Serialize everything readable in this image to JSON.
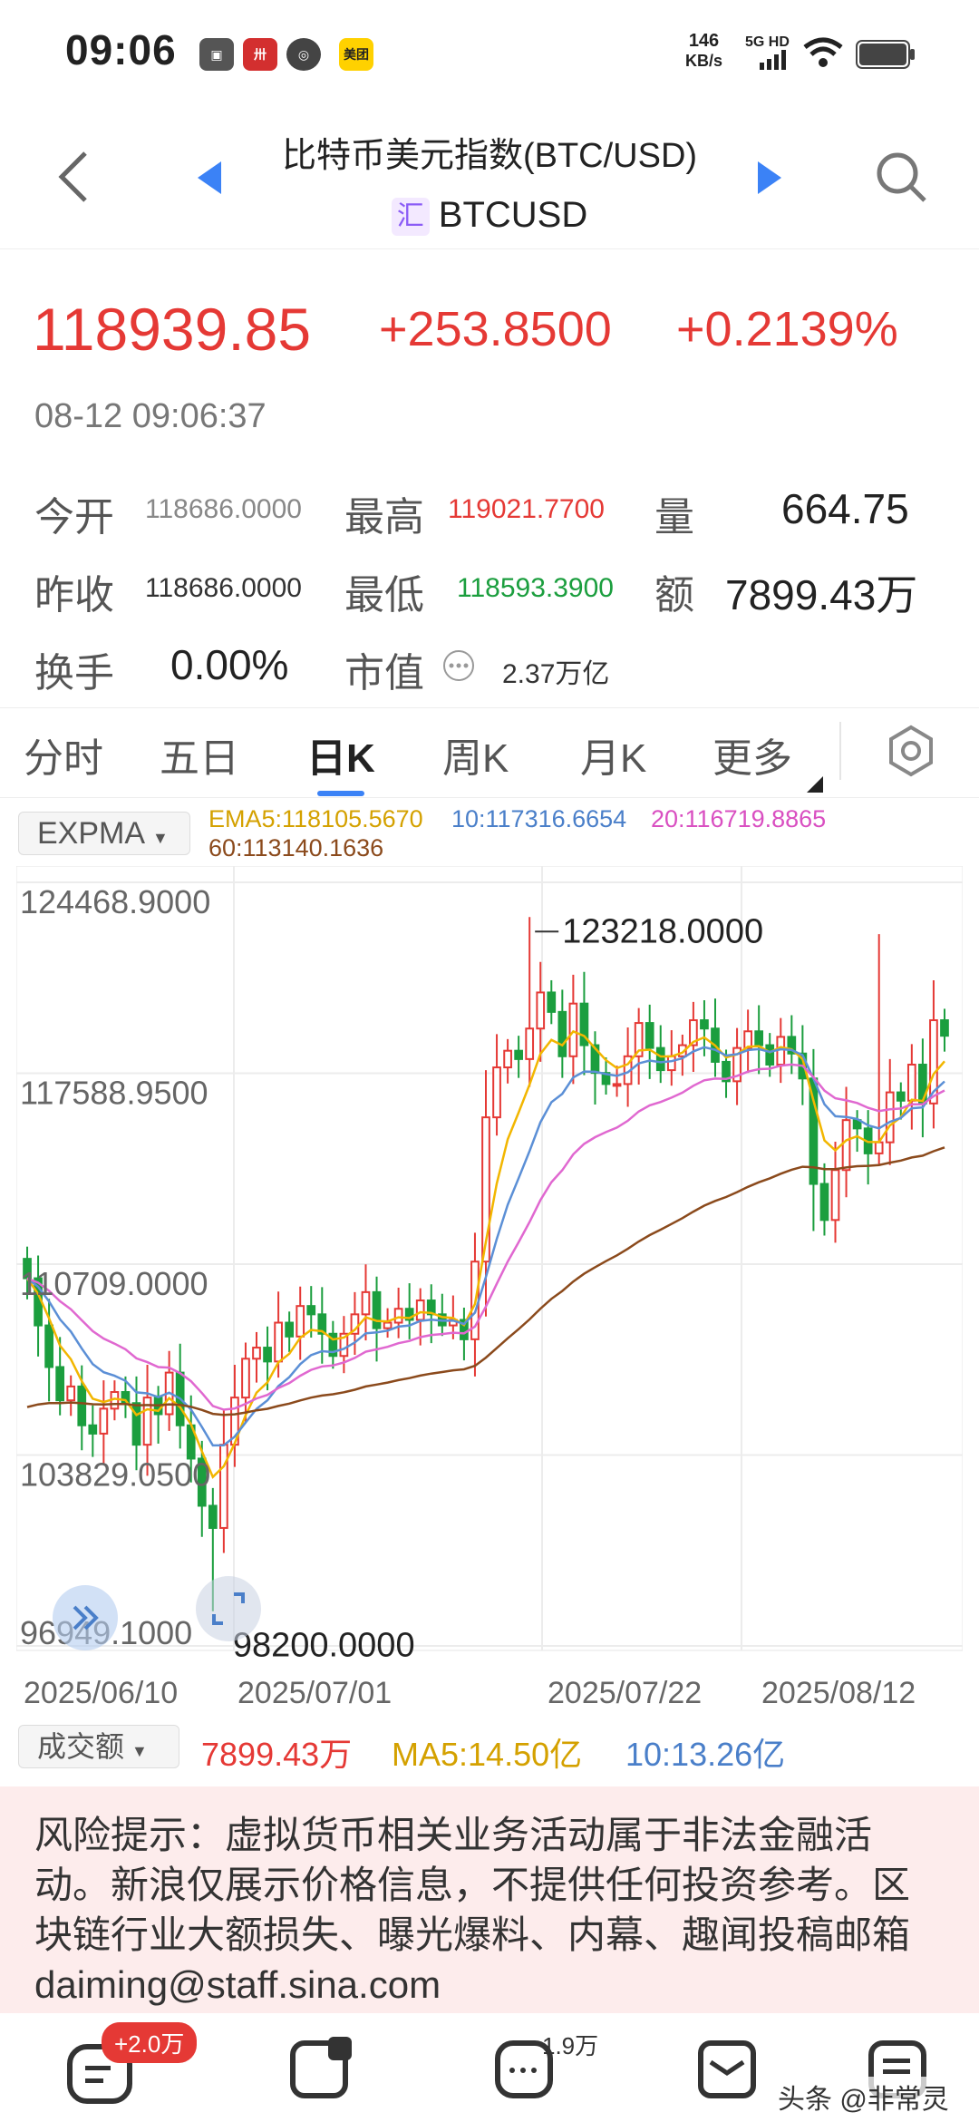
{
  "status": {
    "time": "09:06",
    "net_speed": "146",
    "net_unit": "KB/s",
    "signal": "5G HD",
    "apps": [
      "美团"
    ]
  },
  "nav": {
    "title": "比特币美元指数(BTC/USD)",
    "symbol_tag": "汇",
    "symbol": "BTCUSD"
  },
  "quote": {
    "price": "118939.85",
    "change": "+253.8500",
    "change_pct": "+0.2139%",
    "timestamp": "08-12 09:06:37"
  },
  "stats": {
    "open_label": "今开",
    "open": "118686.0000",
    "high_label": "最高",
    "high": "119021.7700",
    "vol_label": "量",
    "vol": "664.75",
    "prev_label": "昨收",
    "prev": "118686.0000",
    "low_label": "最低",
    "low": "118593.3900",
    "amount_label": "额",
    "amount": "7899.43万",
    "turnover_label": "换手",
    "turnover": "0.00%",
    "mcap_label": "市值",
    "mcap": "2.37万亿"
  },
  "tabs": [
    "分时",
    "五日",
    "日K",
    "周K",
    "月K",
    "更多"
  ],
  "indicator": {
    "name": "EXPMA",
    "ema5": "EMA5:118105.5670",
    "ema10": "10:117316.6654",
    "ema20": "20:116719.8865",
    "ema60": "60:113140.1636"
  },
  "chart_data": {
    "type": "candlestick",
    "y_ticks": [
      "124468.9000",
      "117588.9500",
      "110709.0000",
      "103829.0500",
      "96949.1000"
    ],
    "ylim": [
      96949.1,
      124468.9
    ],
    "x_ticks": [
      "2025/06/10",
      "2025/07/01",
      "2025/07/22",
      "2025/08/12"
    ],
    "max_label": "123218.0000",
    "min_label": "98200.0000",
    "up_color": "#e53935",
    "down_color": "#1b9e3e",
    "closes": [
      110200,
      108500,
      107000,
      105800,
      106300,
      104900,
      104600,
      105500,
      106100,
      105700,
      104200,
      105900,
      105300,
      106800,
      104900,
      103700,
      102000,
      101200,
      104200,
      105900,
      107300,
      107700,
      107200,
      108600,
      108100,
      109200,
      108900,
      108200,
      107400,
      108200,
      108900,
      109700,
      108400,
      108600,
      109100,
      108700,
      109400,
      108900,
      108500,
      108700,
      108000,
      110800,
      116000,
      117800,
      118400,
      118100,
      119200,
      120500,
      119800,
      118200,
      120100,
      118600,
      117600,
      117200,
      117200,
      118200,
      119400,
      118500,
      117700,
      118200,
      118600,
      119500,
      119200,
      118000,
      117300,
      118500,
      119100,
      118600,
      117900,
      118900,
      118300,
      117400,
      113600,
      112300,
      114100,
      115900,
      115600,
      114700,
      115100,
      116900,
      116600,
      117900,
      116500,
      119500,
      118940
    ],
    "ema5_color": "#f2b600",
    "ema10_color": "#5b8fd6",
    "ema20_color": "#e068d0",
    "ema60_color": "#8b4a1c"
  },
  "volume": {
    "label": "成交额",
    "value": "7899.43万",
    "ma5": "MA5:14.50亿",
    "ma10": "10:13.26亿"
  },
  "risk": "风险提示：虚拟货币相关业务活动属于非法金融活动。新浪仅展示价格信息，不提供任何投资参考。区块链行业大额损失、曝光爆料、内幕、趣闻投稿邮箱 daiming@staff.sina.com",
  "bottom": {
    "comment_badge": "+2.0万",
    "count": "1.9万",
    "watermark": "头条 @非常灵性"
  }
}
